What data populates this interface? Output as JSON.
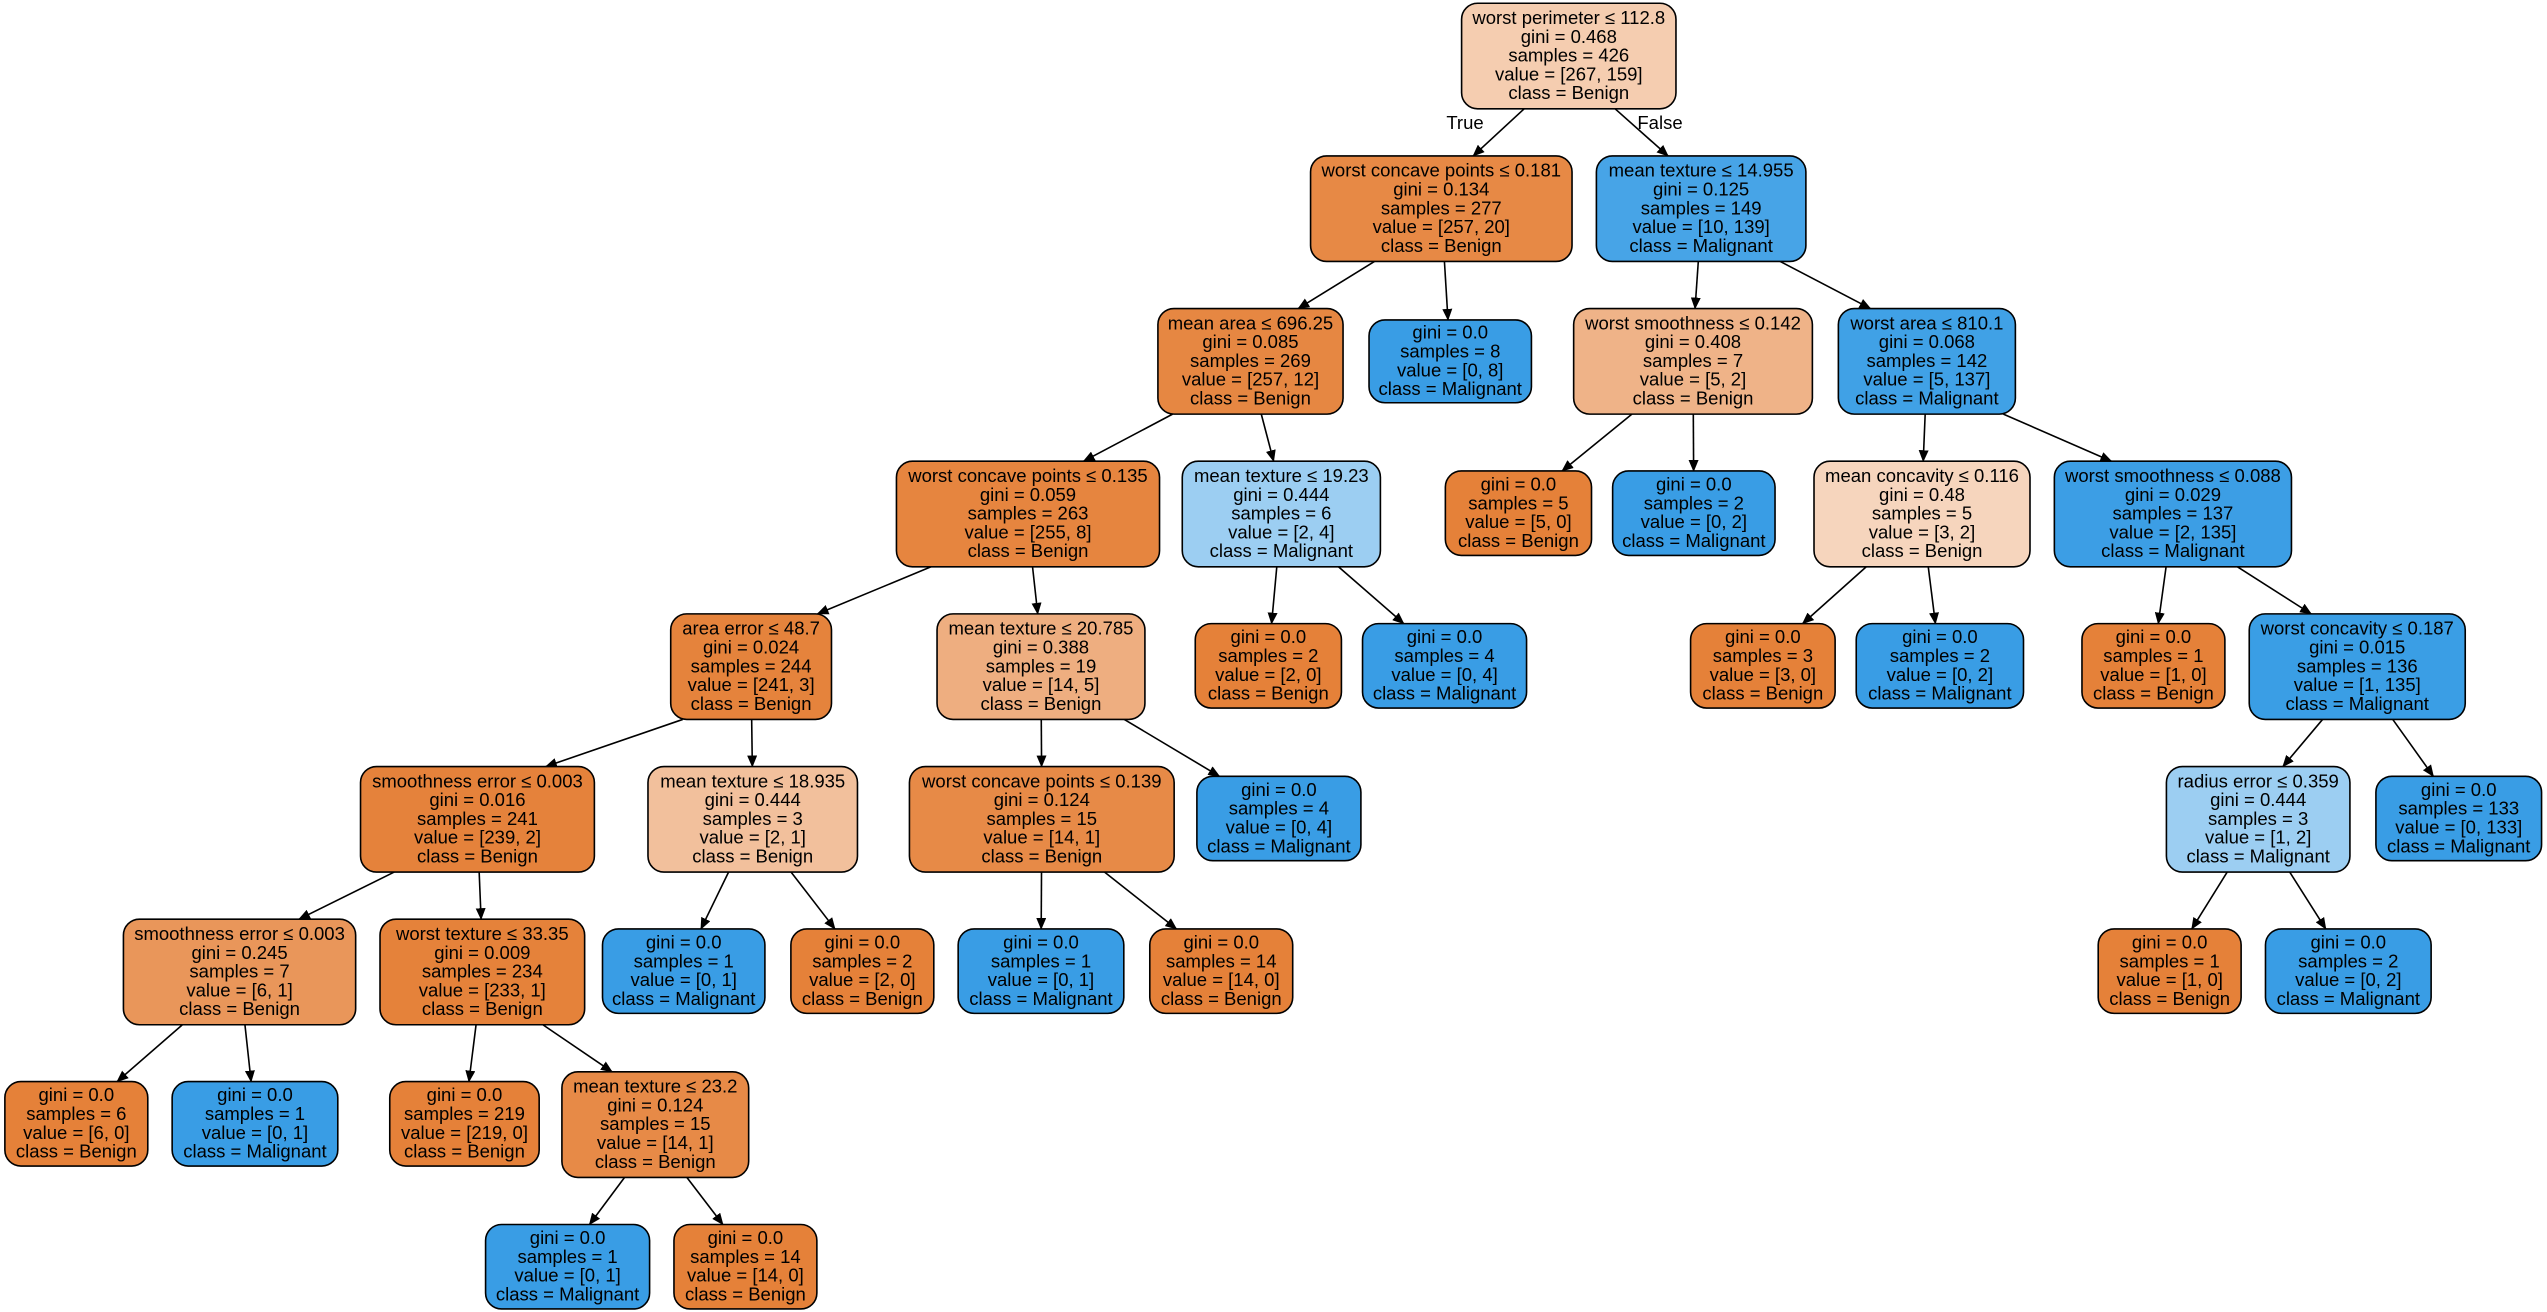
{
  "tree": {
    "class_colors": {
      "Benign": "#e58139",
      "Malignant": "#399de5"
    },
    "edge_labels": {
      "true_label": "True",
      "false_label": "False"
    },
    "nodes": [
      {
        "id": 0,
        "lines": [
          "worst perimeter ≤ 112.8",
          "gini = 0.468",
          "samples = 426",
          "value = [267, 159]",
          "class = Benign"
        ],
        "fill": "#f5cdb0"
      },
      {
        "id": 1,
        "lines": [
          "worst concave points ≤ 0.181",
          "gini = 0.134",
          "samples = 277",
          "value = [257, 20]",
          "class = Benign"
        ],
        "fill": "#e78945"
      },
      {
        "id": 2,
        "lines": [
          "mean texture ≤ 14.955",
          "gini = 0.125",
          "samples = 149",
          "value = [10, 139]",
          "class = Malignant"
        ],
        "fill": "#47a4e7"
      },
      {
        "id": 3,
        "lines": [
          "mean area ≤ 696.25",
          "gini = 0.085",
          "samples = 269",
          "value = [257, 12]",
          "class = Benign"
        ],
        "fill": "#e68742"
      },
      {
        "id": 4,
        "lines": [
          "gini = 0.0",
          "samples = 8",
          "value = [0, 8]",
          "class = Malignant"
        ],
        "fill": "#399de5"
      },
      {
        "id": 5,
        "lines": [
          "worst smoothness ≤ 0.142",
          "gini = 0.408",
          "samples = 7",
          "value = [5, 2]",
          "class = Benign"
        ],
        "fill": "#efb388"
      },
      {
        "id": 6,
        "lines": [
          "worst area ≤ 810.1",
          "gini = 0.068",
          "samples = 142",
          "value = [5, 137]",
          "class = Malignant"
        ],
        "fill": "#40a1e6"
      },
      {
        "id": 7,
        "lines": [
          "worst concave points ≤ 0.135",
          "gini = 0.059",
          "samples = 263",
          "value = [255, 8]",
          "class = Benign"
        ],
        "fill": "#e6853f"
      },
      {
        "id": 8,
        "lines": [
          "mean texture ≤ 19.23",
          "gini = 0.444",
          "samples = 6",
          "value = [2, 4]",
          "class = Malignant"
        ],
        "fill": "#9ccef2"
      },
      {
        "id": 9,
        "lines": [
          "gini = 0.0",
          "samples = 5",
          "value = [5, 0]",
          "class = Benign"
        ],
        "fill": "#e58139"
      },
      {
        "id": 10,
        "lines": [
          "gini = 0.0",
          "samples = 2",
          "value = [0, 2]",
          "class = Malignant"
        ],
        "fill": "#399de5"
      },
      {
        "id": 11,
        "lines": [
          "mean concavity ≤ 0.116",
          "gini = 0.48",
          "samples = 5",
          "value = [3, 2]",
          "class = Benign"
        ],
        "fill": "#f6d5bd"
      },
      {
        "id": 12,
        "lines": [
          "worst smoothness ≤ 0.088",
          "gini = 0.029",
          "samples = 137",
          "value = [2, 135]",
          "class = Malignant"
        ],
        "fill": "#3c9ee5"
      },
      {
        "id": 13,
        "lines": [
          "area error ≤ 48.7",
          "gini = 0.024",
          "samples = 244",
          "value = [241, 3]",
          "class = Benign"
        ],
        "fill": "#e5833c"
      },
      {
        "id": 14,
        "lines": [
          "mean texture ≤ 20.785",
          "gini = 0.388",
          "samples = 19",
          "value = [14, 5]",
          "class = Benign"
        ],
        "fill": "#eeae80"
      },
      {
        "id": 15,
        "lines": [
          "gini = 0.0",
          "samples = 2",
          "value = [2, 0]",
          "class = Benign"
        ],
        "fill": "#e58139"
      },
      {
        "id": 16,
        "lines": [
          "gini = 0.0",
          "samples = 4",
          "value = [0, 4]",
          "class = Malignant"
        ],
        "fill": "#399de5"
      },
      {
        "id": 17,
        "lines": [
          "gini = 0.0",
          "samples = 3",
          "value = [3, 0]",
          "class = Benign"
        ],
        "fill": "#e58139"
      },
      {
        "id": 18,
        "lines": [
          "gini = 0.0",
          "samples = 2",
          "value = [0, 2]",
          "class = Malignant"
        ],
        "fill": "#399de5"
      },
      {
        "id": 19,
        "lines": [
          "gini = 0.0",
          "samples = 1",
          "value = [1, 0]",
          "class = Benign"
        ],
        "fill": "#e58139"
      },
      {
        "id": 20,
        "lines": [
          "worst concavity ≤ 0.187",
          "gini = 0.015",
          "samples = 136",
          "value = [1, 135]",
          "class = Malignant"
        ],
        "fill": "#3a9ee5"
      },
      {
        "id": 21,
        "lines": [
          "smoothness error ≤ 0.003",
          "gini = 0.016",
          "samples = 241",
          "value = [239, 2]",
          "class = Benign"
        ],
        "fill": "#e5823b"
      },
      {
        "id": 22,
        "lines": [
          "mean texture ≤ 18.935",
          "gini = 0.444",
          "samples = 3",
          "value = [2, 1]",
          "class = Benign"
        ],
        "fill": "#f2c09c"
      },
      {
        "id": 23,
        "lines": [
          "worst concave points ≤ 0.139",
          "gini = 0.124",
          "samples = 15",
          "value = [14, 1]",
          "class = Benign"
        ],
        "fill": "#e78a47"
      },
      {
        "id": 24,
        "lines": [
          "gini = 0.0",
          "samples = 4",
          "value = [0, 4]",
          "class = Malignant"
        ],
        "fill": "#399de5"
      },
      {
        "id": 25,
        "lines": [
          "radius error ≤ 0.359",
          "gini = 0.444",
          "samples = 3",
          "value = [1, 2]",
          "class = Malignant"
        ],
        "fill": "#9ccef2"
      },
      {
        "id": 26,
        "lines": [
          "gini = 0.0",
          "samples = 133",
          "value = [0, 133]",
          "class = Malignant"
        ],
        "fill": "#399de5"
      },
      {
        "id": 27,
        "lines": [
          "smoothness error ≤ 0.003",
          "gini = 0.245",
          "samples = 7",
          "value = [6, 1]",
          "class = Benign"
        ],
        "fill": "#e9965a"
      },
      {
        "id": 28,
        "lines": [
          "worst texture ≤ 33.35",
          "gini = 0.009",
          "samples = 234",
          "value = [233, 1]",
          "class = Benign"
        ],
        "fill": "#e5823a"
      },
      {
        "id": 29,
        "lines": [
          "gini = 0.0",
          "samples = 1",
          "value = [0, 1]",
          "class = Malignant"
        ],
        "fill": "#399de5"
      },
      {
        "id": 30,
        "lines": [
          "gini = 0.0",
          "samples = 2",
          "value = [2, 0]",
          "class = Benign"
        ],
        "fill": "#e58139"
      },
      {
        "id": 31,
        "lines": [
          "gini = 0.0",
          "samples = 1",
          "value = [0, 1]",
          "class = Malignant"
        ],
        "fill": "#399de5"
      },
      {
        "id": 32,
        "lines": [
          "gini = 0.0",
          "samples = 14",
          "value = [14, 0]",
          "class = Benign"
        ],
        "fill": "#e58139"
      },
      {
        "id": 33,
        "lines": [
          "gini = 0.0",
          "samples = 1",
          "value = [1, 0]",
          "class = Benign"
        ],
        "fill": "#e58139"
      },
      {
        "id": 34,
        "lines": [
          "gini = 0.0",
          "samples = 2",
          "value = [0, 2]",
          "class = Malignant"
        ],
        "fill": "#399de5"
      },
      {
        "id": 35,
        "lines": [
          "gini = 0.0",
          "samples = 6",
          "value = [6, 0]",
          "class = Benign"
        ],
        "fill": "#e58139"
      },
      {
        "id": 36,
        "lines": [
          "gini = 0.0",
          "samples = 1",
          "value = [0, 1]",
          "class = Malignant"
        ],
        "fill": "#399de5"
      },
      {
        "id": 37,
        "lines": [
          "gini = 0.0",
          "samples = 219",
          "value = [219, 0]",
          "class = Benign"
        ],
        "fill": "#e58139"
      },
      {
        "id": 38,
        "lines": [
          "mean texture ≤ 23.2",
          "gini = 0.124",
          "samples = 15",
          "value = [14, 1]",
          "class = Benign"
        ],
        "fill": "#e78a47"
      },
      {
        "id": 39,
        "lines": [
          "gini = 0.0",
          "samples = 1",
          "value = [0, 1]",
          "class = Malignant"
        ],
        "fill": "#399de5"
      },
      {
        "id": 40,
        "lines": [
          "gini = 0.0",
          "samples = 14",
          "value = [14, 0]",
          "class = Benign"
        ],
        "fill": "#e58139"
      }
    ],
    "edges": [
      [
        0,
        1
      ],
      [
        0,
        2
      ],
      [
        1,
        3
      ],
      [
        1,
        4
      ],
      [
        2,
        5
      ],
      [
        2,
        6
      ],
      [
        3,
        7
      ],
      [
        3,
        8
      ],
      [
        5,
        9
      ],
      [
        5,
        10
      ],
      [
        6,
        11
      ],
      [
        6,
        12
      ],
      [
        7,
        13
      ],
      [
        7,
        14
      ],
      [
        8,
        15
      ],
      [
        8,
        16
      ],
      [
        11,
        17
      ],
      [
        11,
        18
      ],
      [
        12,
        19
      ],
      [
        12,
        20
      ],
      [
        13,
        21
      ],
      [
        13,
        22
      ],
      [
        14,
        23
      ],
      [
        14,
        24
      ],
      [
        20,
        25
      ],
      [
        20,
        26
      ],
      [
        21,
        27
      ],
      [
        21,
        28
      ],
      [
        22,
        29
      ],
      [
        22,
        30
      ],
      [
        23,
        31
      ],
      [
        23,
        32
      ],
      [
        25,
        33
      ],
      [
        25,
        34
      ],
      [
        27,
        35
      ],
      [
        27,
        36
      ],
      [
        28,
        37
      ],
      [
        28,
        38
      ],
      [
        38,
        39
      ],
      [
        38,
        40
      ]
    ]
  }
}
